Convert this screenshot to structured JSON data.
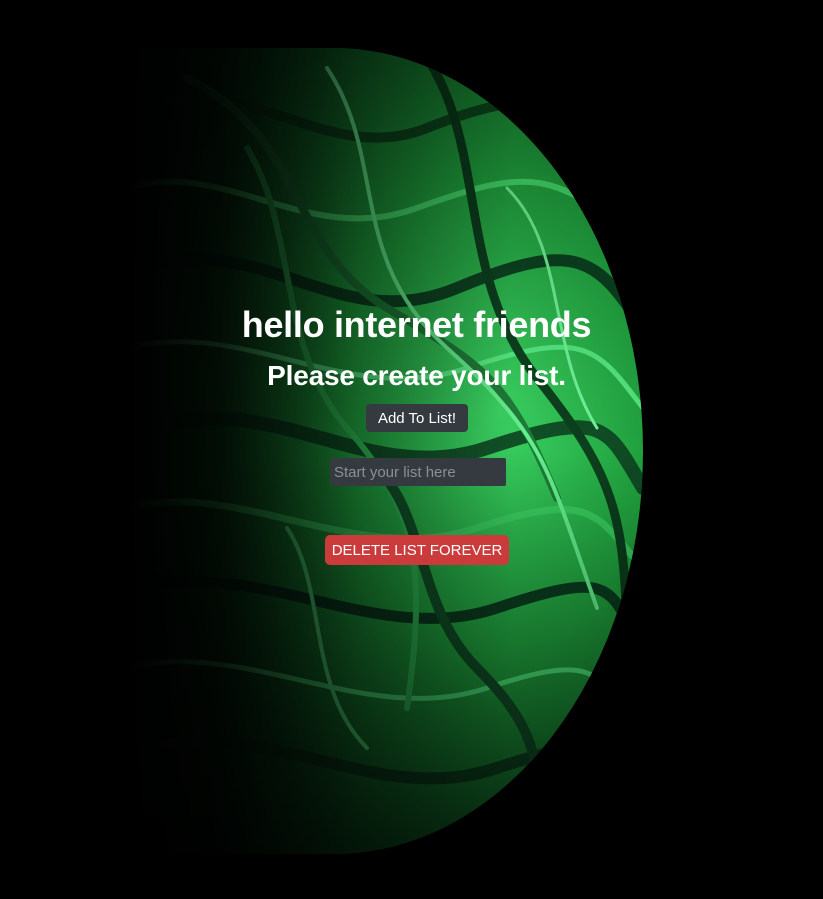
{
  "page": {
    "title": "hello internet friends",
    "subtitle": "Please create your list."
  },
  "actions": {
    "add_label": "Add To List!",
    "delete_label": "DELETE LIST FOREVER"
  },
  "list_input": {
    "value": "",
    "placeholder": "Start your list here"
  },
  "background": {
    "image": "green-marbled-planet",
    "page_color": "#000000",
    "planet_color": "#2bbd4f"
  },
  "colors": {
    "button_dark": "#343a40",
    "button_danger": "#cc3b3b",
    "text": "#ffffff"
  }
}
